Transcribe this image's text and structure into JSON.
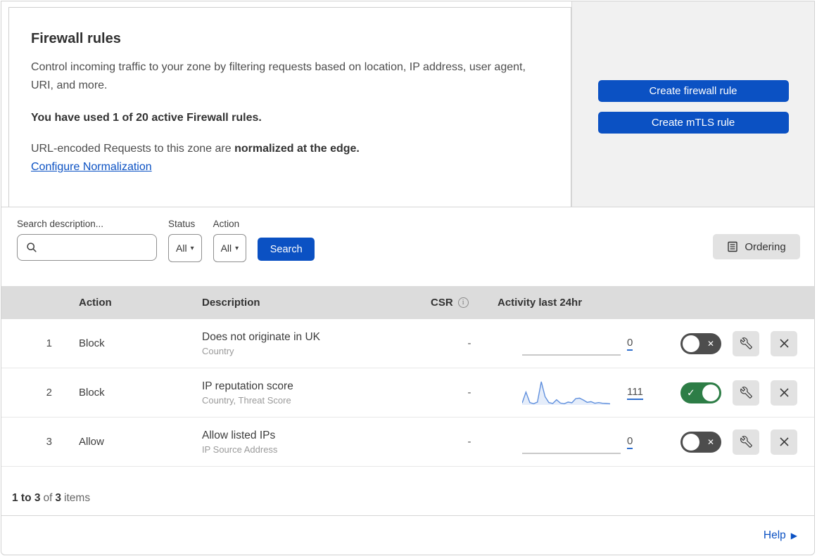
{
  "colors": {
    "accent_blue": "#0b51c3",
    "toggle_on_green": "#2d7d46",
    "toggle_off_gray": "#4d4d4d",
    "sparkline_blue": "#5f8fdd",
    "side_panel_gray": "#f1f1f1",
    "table_header_gray": "#dcdcdc"
  },
  "icons": {
    "chevron_down": "▾",
    "toggle_check": "✓",
    "toggle_x": "✕",
    "info_i": "i",
    "help_arrow": "▶"
  },
  "header": {
    "title": "Firewall rules",
    "description": "Control incoming traffic to your zone by filtering requests based on location, IP address, user agent, URI, and more.",
    "usage_note": "You have used 1 of 20 active Firewall rules.",
    "normalization_text": "URL-encoded Requests to this zone are ",
    "normalization_bold": "normalized at the edge.",
    "normalization_link": "Configure Normalization",
    "create_firewall_button": "Create firewall rule",
    "create_mtls_button": "Create mTLS rule"
  },
  "filters": {
    "search_label": "Search description...",
    "status_label": "Status",
    "status_value": "All",
    "action_label": "Action",
    "action_value": "All",
    "search_button": "Search",
    "ordering_button": "Ordering"
  },
  "table": {
    "headers": {
      "action": "Action",
      "description": "Description",
      "csr": "CSR",
      "activity": "Activity last 24hr"
    },
    "rows": [
      {
        "priority": "1",
        "action": "Block",
        "description": "Does not originate in UK",
        "match_fields": "Country",
        "csr": "-",
        "activity_count": "0",
        "enabled": false
      },
      {
        "priority": "2",
        "action": "Block",
        "description": "IP reputation score",
        "match_fields": "Country, Threat Score",
        "csr": "-",
        "activity_count": "111",
        "enabled": true
      },
      {
        "priority": "3",
        "action": "Allow",
        "description": "Allow listed IPs",
        "match_fields": "IP Source Address",
        "csr": "-",
        "activity_count": "0",
        "enabled": false
      }
    ]
  },
  "pagination": {
    "range": "1 to 3",
    "of": "of",
    "total": "3",
    "items_label": "items"
  },
  "footer": {
    "help_label": "Help"
  },
  "chart_data": {
    "type": "area",
    "title": "Activity last 24hr sparkline (rule 2)",
    "total_requests": 111,
    "ylim": [
      0,
      100
    ],
    "values": [
      8,
      55,
      10,
      5,
      12,
      100,
      35,
      10,
      6,
      22,
      8,
      5,
      12,
      9,
      27,
      29,
      21,
      11,
      14,
      7,
      10,
      7,
      6,
      5
    ]
  }
}
